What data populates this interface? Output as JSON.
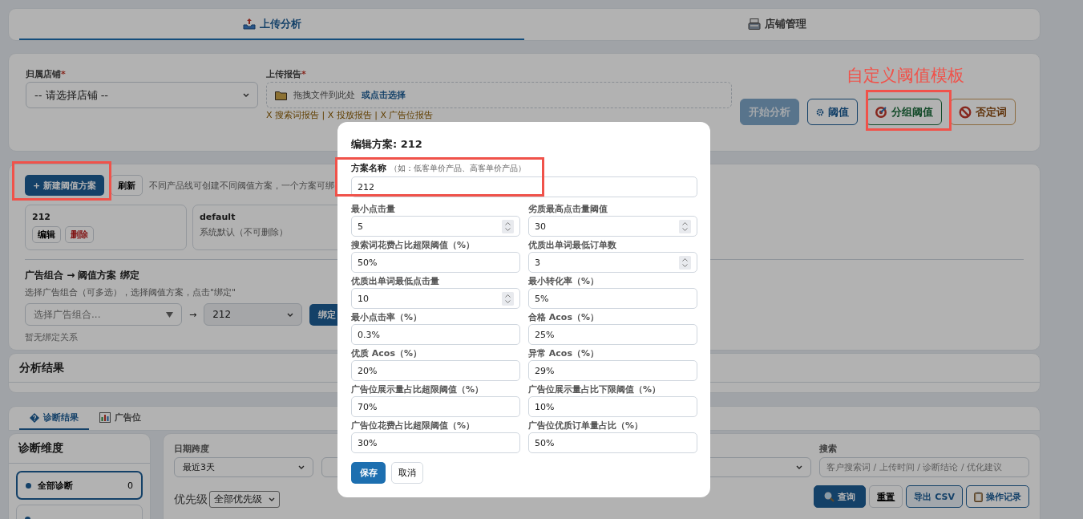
{
  "top_tabs": [
    {
      "label": "上传分析",
      "selected": true
    },
    {
      "label": "店铺管理",
      "selected": false
    }
  ],
  "upload": {
    "store_label": "归属店铺",
    "store_required": "*",
    "store_select": "-- 请选择店铺 --",
    "report_label": "上传报告",
    "report_required": "*",
    "drop_text": "拖拽文件到此处",
    "drop_link": "或点击选择",
    "report_status": "X 搜索词报告 | X 投放报告 | X 广告位报告",
    "buttons": [
      {
        "label": "开始分析",
        "kind": "primary",
        "disabled": true
      },
      {
        "label": "阈值",
        "kind": "blue",
        "disabled": false
      },
      {
        "label": "分组阈值",
        "kind": "green",
        "disabled": false
      },
      {
        "label": "否定词",
        "kind": "orange",
        "disabled": false
      }
    ]
  },
  "annotation": "自定义阈值模板",
  "thresholds": {
    "new_button": "+ 新建阈值方案",
    "refresh_button": "刷新",
    "hint": "不同产品线可创建不同阈值方案，一个方案可绑",
    "schemes": [
      {
        "name": "212",
        "deletable": true,
        "edit": "编辑",
        "delete": "删除"
      },
      {
        "name": "default",
        "deletable": false,
        "note": "系统默认（不可删除）"
      }
    ],
    "binding_title": "广告组合 → 阈值方案 绑定",
    "binding_hint": "选择广告组合（可多选），选择阈值方案，点击\"绑定\"",
    "group_placeholder": "选择广告组合...",
    "arrow": "→",
    "scheme_select": "212",
    "bind_button": "绑定",
    "empty": "暂无绑定关系"
  },
  "results": {
    "title": "分析结果"
  },
  "result_tabs": [
    {
      "label": "诊断结果",
      "selected": true
    },
    {
      "label": "广告位",
      "selected": false
    }
  ],
  "sidebar": {
    "title": "诊断维度",
    "items": [
      {
        "label": "全部诊断",
        "count": "0",
        "selected": true
      },
      {
        "selected": false
      }
    ]
  },
  "filters": {
    "date_label": "日期跨度",
    "date_value": "最近3天",
    "search_label": "搜索",
    "search_placeholder": "客户搜索词 / 上传时间 / 诊断结论 / 优化建议",
    "priority_label": "优先级",
    "priority_value": "全部优先级",
    "buttons": [
      {
        "label": "查询",
        "kind": "search"
      },
      {
        "label": "重置",
        "kind": "plain"
      },
      {
        "label": "导出 CSV",
        "kind": "export"
      },
      {
        "label": "操作记录",
        "kind": "log"
      }
    ]
  },
  "modal": {
    "title": "编辑方案: 212",
    "name_label": "方案名称",
    "name_hint": "（如：低客单价产品、高客单价产品）",
    "name_value": "212",
    "fields": [
      {
        "label": "最小点击量",
        "value": "5",
        "kind": "number"
      },
      {
        "label": "劣质最高点击量阈值",
        "value": "30",
        "kind": "number"
      },
      {
        "label": "搜索词花费占比超限阈值（%）",
        "value": "50%",
        "kind": "text"
      },
      {
        "label": "优质出单词最低订单数",
        "value": "3",
        "kind": "number"
      },
      {
        "label": "优质出单词最低点击量",
        "value": "10",
        "kind": "number"
      },
      {
        "label": "最小转化率（%）",
        "value": "5%",
        "kind": "text"
      },
      {
        "label": "最小点击率（%）",
        "value": "0.3%",
        "kind": "text"
      },
      {
        "label": "合格 Acos（%）",
        "value": "25%",
        "kind": "text"
      },
      {
        "label": "优质 Acos（%）",
        "value": "20%",
        "kind": "text"
      },
      {
        "label": "异常 Acos（%）",
        "value": "29%",
        "kind": "text"
      },
      {
        "label": "广告位展示量占比超限阈值（%）",
        "value": "70%",
        "kind": "text"
      },
      {
        "label": "广告位展示量占比下限阈值（%）",
        "value": "10%",
        "kind": "text"
      },
      {
        "label": "广告位花费占比超限阈值（%）",
        "value": "30%",
        "kind": "text"
      },
      {
        "label": "广告位优质订单量占比（%）",
        "value": "50%",
        "kind": "text"
      }
    ],
    "save": "保存",
    "cancel": "取消"
  }
}
